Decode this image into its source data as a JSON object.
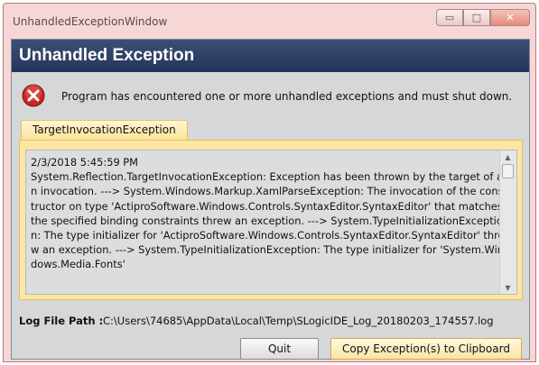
{
  "window": {
    "title": "UnhandledExceptionWindow",
    "controls": {
      "minimize": "▭",
      "maximize": "□",
      "close": "✕"
    }
  },
  "header": {
    "title": "Unhandled Exception"
  },
  "message": {
    "icon": "error-icon",
    "text": "Program has encountered one or more unhandled exceptions and must shut down."
  },
  "tabs": [
    {
      "label": "TargetInvocationException",
      "selected": true
    }
  ],
  "exception_text": "2/3/2018 5:45:59 PM\nSystem.Reflection.TargetInvocationException: Exception has been thrown by the target of an invocation. ---> System.Windows.Markup.XamlParseException: The invocation of the constructor on type 'ActiproSoftware.Windows.Controls.SyntaxEditor.SyntaxEditor' that matches the specified binding constraints threw an exception. ---> System.TypeInitializationException: The type initializer for 'ActiproSoftware.Windows.Controls.SyntaxEditor.SyntaxEditor' threw an exception. ---> System.TypeInitializationException: The type initializer for 'System.Windows.Media.Fonts'",
  "log": {
    "label": "Log File Path :",
    "path": "C:\\Users\\74685\\AppData\\Local\\Temp\\SLogicIDE_Log_20180203_174557.log"
  },
  "buttons": {
    "quit": "Quit",
    "copy": "Copy Exception(s) to Clipboard"
  },
  "colors": {
    "header_bg": "#2c3e66",
    "tab_bg": "#fbe39a",
    "window_frame": "#f7d6d6"
  }
}
